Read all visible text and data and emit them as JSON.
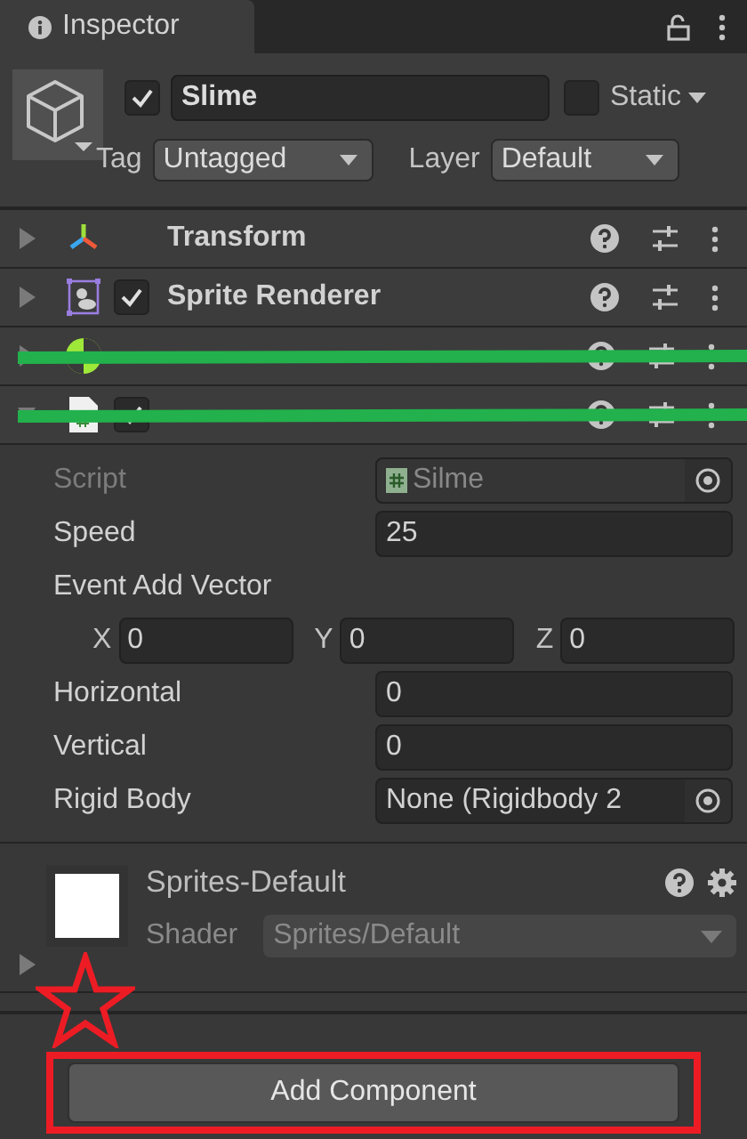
{
  "tab": {
    "title": "Inspector"
  },
  "object": {
    "active": true,
    "name": "Slime",
    "static": false,
    "static_label": "Static",
    "tag_label": "Tag",
    "tag": "Untagged",
    "layer_label": "Layer",
    "layer": "Default"
  },
  "components": [
    {
      "kind": "transform",
      "name": "Transform",
      "expanded": false,
      "struck": false
    },
    {
      "kind": "sprite",
      "name": "Sprite Renderer",
      "enabled": true,
      "expanded": false,
      "struck": false
    },
    {
      "kind": "rigidbody",
      "expanded": false,
      "struck": true
    },
    {
      "kind": "script",
      "enabled": true,
      "expanded": true,
      "struck": true
    }
  ],
  "fields": [
    {
      "kind": "object",
      "label": "Script",
      "value": "Silme",
      "disabled": true
    },
    {
      "kind": "text",
      "label": "Speed",
      "value": "25"
    },
    {
      "kind": "vector",
      "label": "Event Add Vector",
      "axes": [
        {
          "axis": "X",
          "value": "0"
        },
        {
          "axis": "Y",
          "value": "0"
        },
        {
          "axis": "Z",
          "value": "0"
        }
      ]
    },
    {
      "kind": "text",
      "label": "Horizontal",
      "value": "0"
    },
    {
      "kind": "text",
      "label": "Vertical",
      "value": "0"
    },
    {
      "kind": "object",
      "label": "Rigid Body",
      "value": "None (Rigidbody 2",
      "disabled": false
    }
  ],
  "material": {
    "name": "Sprites-Default",
    "shader_label": "Shader",
    "shader": "Sprites/Default"
  },
  "add_button": {
    "label": "Add Component",
    "highlighted": true
  },
  "star_mark": true
}
